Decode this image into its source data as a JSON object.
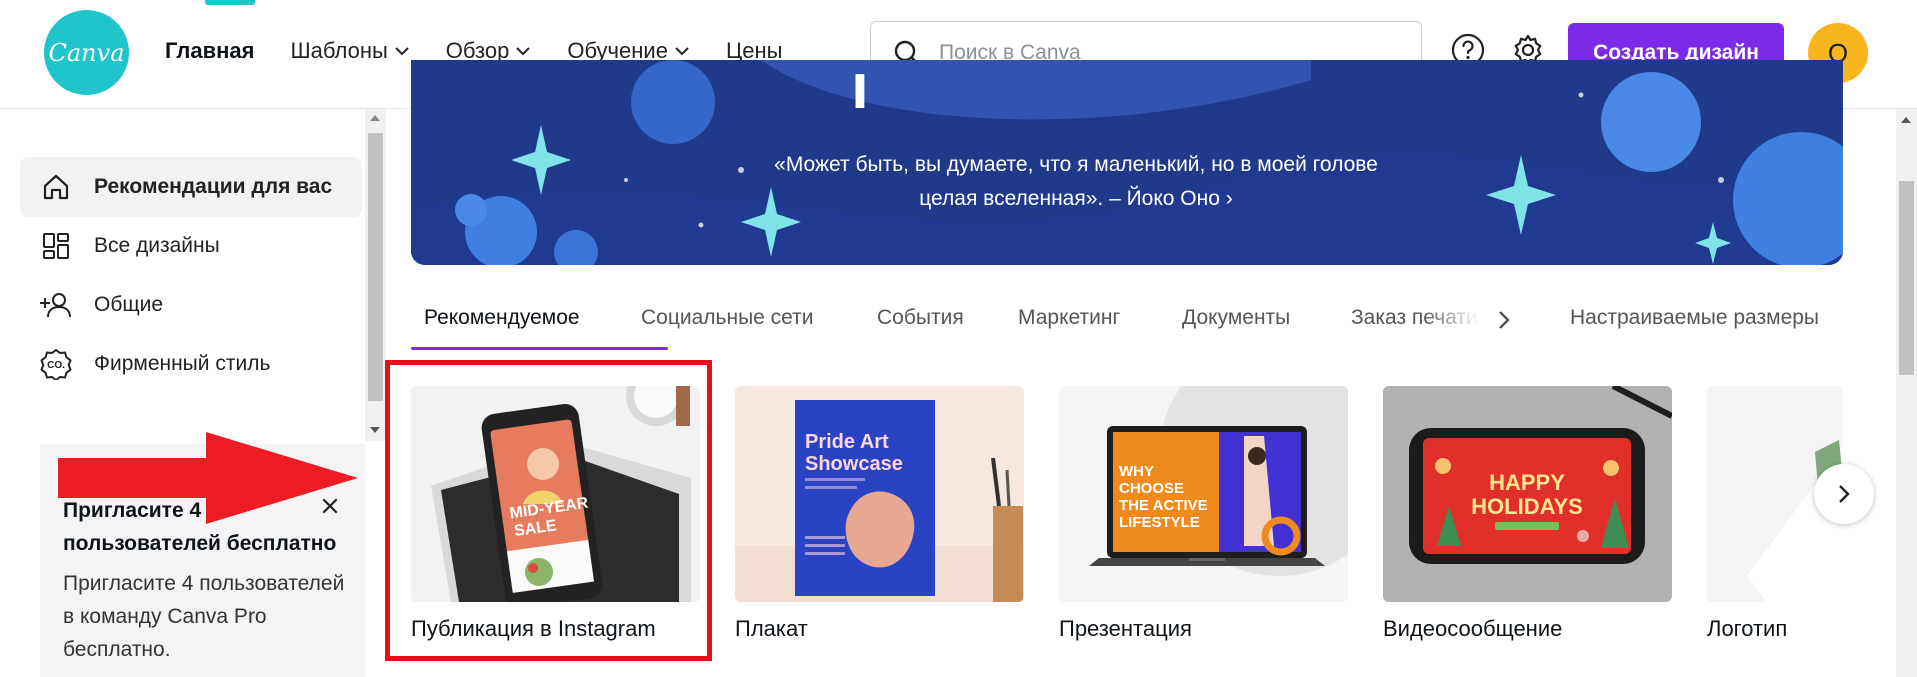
{
  "header": {
    "logo_text": "Canva",
    "nav": [
      {
        "label": "Главная",
        "dropdown": false,
        "active": true
      },
      {
        "label": "Шаблоны",
        "dropdown": true
      },
      {
        "label": "Обзор",
        "dropdown": true
      },
      {
        "label": "Обучение",
        "dropdown": true
      },
      {
        "label": "Цены",
        "dropdown": false
      }
    ],
    "search_placeholder": "Поиск в Canva",
    "create_button": "Создать дизайн",
    "avatar_letter": "O",
    "icons": [
      "help-icon",
      "settings-icon"
    ]
  },
  "sidebar": {
    "items": [
      {
        "label": "Рекомендации для вас",
        "icon": "home-icon",
        "active": true
      },
      {
        "label": "Все дизайны",
        "icon": "grid-icon"
      },
      {
        "label": "Общие",
        "icon": "people-icon"
      },
      {
        "label": "Фирменный стиль",
        "icon": "brand-icon"
      }
    ]
  },
  "invite": {
    "title": "Пригласите 4 пользователей бесплатно",
    "text": "Пригласите 4 пользователей в команду Canva Pro бесплатно."
  },
  "banner": {
    "quote_line1": "«Может быть, вы думаете, что я маленький, но в моей голове",
    "quote_line2": "целая вселенная». – Йоко Оно ›"
  },
  "tabs": [
    {
      "label": "Рекомендуемое",
      "active": true
    },
    {
      "label": "Социальные сети"
    },
    {
      "label": "События"
    },
    {
      "label": "Маркетинг"
    },
    {
      "label": "Документы"
    },
    {
      "label": "Заказ печати"
    },
    {
      "label": "Настраиваемые размеры"
    }
  ],
  "cards": [
    {
      "label": "Публикация в Instagram",
      "thumb_text": [
        "MID-YEAR",
        "SALE"
      ]
    },
    {
      "label": "Плакат",
      "thumb_text": [
        "Pride Art",
        "Showcase"
      ]
    },
    {
      "label": "Презентация",
      "thumb_text": [
        "WHY",
        "CHOOSE",
        "THE ACTIVE",
        "LIFESTYLE"
      ]
    },
    {
      "label": "Видеосообщение",
      "thumb_text": [
        "HAPPY",
        "HOLIDAYS"
      ]
    },
    {
      "label": "Логотип"
    }
  ],
  "colors": {
    "accent": "#7d2ae8",
    "logo": "#20c4cb",
    "avatar": "#f8b51d",
    "banner": "#1f3a8a",
    "highlight": "#e3101c"
  }
}
